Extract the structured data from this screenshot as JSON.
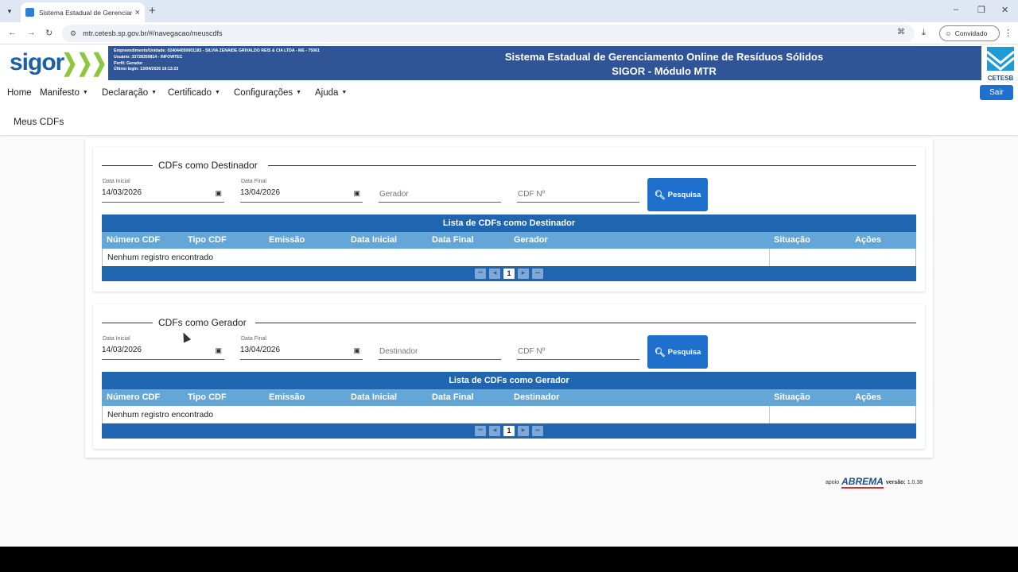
{
  "browser": {
    "tab_title": "Sistema Estadual de Gerenciam",
    "tab_close": "×",
    "new_tab": "+",
    "url": "mtr.cetesb.sp.gov.br/#/navegacao/meuscdfs",
    "profile_label": "Convidado",
    "window_controls": [
      "–",
      "❐",
      "✕"
    ]
  },
  "header": {
    "logo_text": "sigor",
    "info_lines": [
      "Empreendimento/Unidade: 024044050001183 - SILVIA ZENAIDE GRIVALDO REIS & CIA LTDA - ME - 75061",
      "Usuário: 33728359814 - INFOWTEC",
      "Perfil: Gerador",
      "Último login: 13/04/2026 19:13:23"
    ],
    "title_line1": "Sistema Estadual de Gerenciamento Online de Resíduos Sólidos",
    "title_line2": "SIGOR - Módulo MTR",
    "org_logo_label": "CETESB"
  },
  "menu": {
    "items": [
      "Home",
      "Manifesto",
      "Declaração",
      "Certificado",
      "Configurações",
      "Ajuda"
    ],
    "logout_label": "Sair"
  },
  "page": {
    "title": "Meus CDFs"
  },
  "destinador": {
    "legend": "CDFs como Destinador",
    "start_label": "Data Inicial",
    "start_value": "14/03/2026",
    "end_label": "Data Final",
    "end_value": "13/04/2026",
    "party_placeholder": "Gerador",
    "cdf_placeholder": "CDF Nº",
    "search_label": "Pesquisa",
    "table_caption": "Lista de CDFs como Destinador",
    "columns": [
      "Número CDF",
      "Tipo CDF",
      "Emissão",
      "Data Inicial",
      "Data Final",
      "Gerador",
      "Situação",
      "Ações"
    ],
    "empty_message": "Nenhum registro encontrado",
    "current_page": "1"
  },
  "gerador": {
    "legend": "CDFs como Gerador",
    "start_label": "Data Inicial",
    "start_value": "14/03/2026",
    "end_label": "Data Final",
    "end_value": "13/04/2026",
    "party_placeholder": "Destinador",
    "cdf_placeholder": "CDF Nº",
    "search_label": "Pesquisa",
    "table_caption": "Lista de CDFs como Gerador",
    "columns": [
      "Número CDF",
      "Tipo CDF",
      "Emissão",
      "Data Inicial",
      "Data Final",
      "Destinador",
      "Situação",
      "Ações"
    ],
    "empty_message": "Nenhum registro encontrado",
    "current_page": "1"
  },
  "footer": {
    "apoio_label": "apoio",
    "apoio_logo": "ABREMA",
    "version_label": "versão:",
    "version_value": "1.0.38"
  },
  "colors": {
    "header_band": "#2f5597",
    "primary_button": "#1f6fcc",
    "table_caption": "#2065b0",
    "table_header": "#65a6d8",
    "logo_green": "#8dc63f"
  }
}
